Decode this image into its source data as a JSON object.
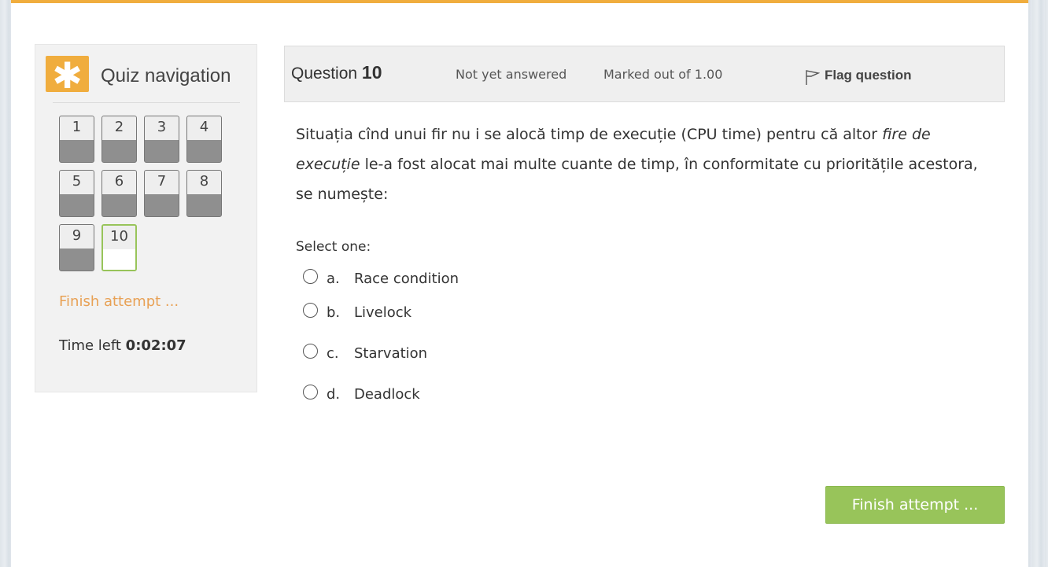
{
  "nav": {
    "title": "Quiz navigation",
    "icon": "asterisk-icon",
    "accent_color": "#f0ad3e",
    "questions": [
      {
        "label": "1",
        "state": "answered"
      },
      {
        "label": "2",
        "state": "answered"
      },
      {
        "label": "3",
        "state": "answered"
      },
      {
        "label": "4",
        "state": "answered"
      },
      {
        "label": "5",
        "state": "answered"
      },
      {
        "label": "6",
        "state": "answered"
      },
      {
        "label": "7",
        "state": "answered"
      },
      {
        "label": "8",
        "state": "answered"
      },
      {
        "label": "9",
        "state": "answered"
      },
      {
        "label": "10",
        "state": "current"
      }
    ],
    "finish_link": "Finish attempt ...",
    "time_left_label": "Time left",
    "time_left_value": "0:02:07"
  },
  "question": {
    "label": "Question",
    "number": "10",
    "state": "Not yet answered",
    "grade": "Marked out of 1.00",
    "flag_label": "Flag question",
    "text_part1": "Situația cînd unui fir nu i se alocă timp de execuție (CPU time) pentru că altor ",
    "text_italic": "fire de execuție",
    "text_part2": " le-a fost alocat mai multe cuante de timp,  în conformitate cu prioritățile acestora, se numește:",
    "prompt": "Select one:",
    "answers": [
      {
        "letter": "a.",
        "text": "Race condition"
      },
      {
        "letter": "b.",
        "text": "Livelock"
      },
      {
        "letter": "c.",
        "text": "Starvation"
      },
      {
        "letter": "d.",
        "text": "Deadlock"
      }
    ]
  },
  "footer": {
    "finish_button": "Finish attempt ..."
  }
}
